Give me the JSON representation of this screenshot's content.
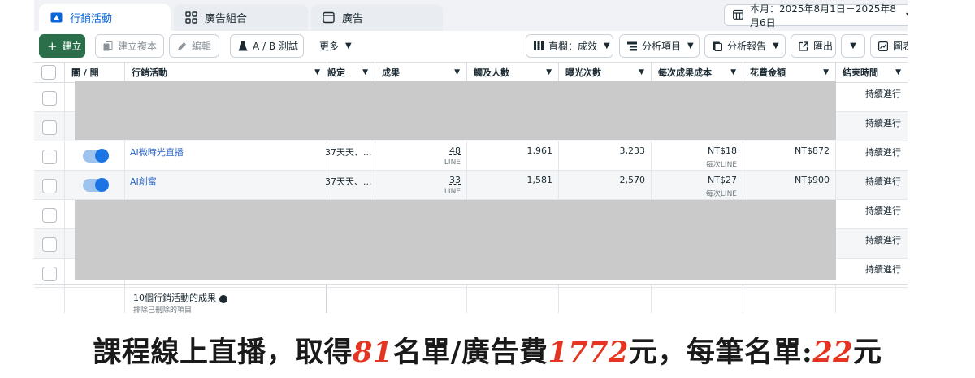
{
  "tabs": [
    {
      "label": "行銷活動",
      "icon": "campaign-icon"
    },
    {
      "label": "廣告組合",
      "icon": "grid-icon"
    },
    {
      "label": "廣告",
      "icon": "ad-icon"
    }
  ],
  "date_range": "本月：2025年8月1日－2025年8月6日",
  "toolbar": {
    "create": "建立",
    "duplicate": "建立複本",
    "edit": "編輯",
    "ab_test": "A / B 測試",
    "more": "更多",
    "columns": "直欄：成效",
    "breakdown": "分析項目",
    "reports": "分析報告",
    "export": "匯出",
    "chart": "圖表"
  },
  "columns": {
    "toggle": "關 / 開",
    "campaign": "行銷活動",
    "setting": "設定",
    "results": "成果",
    "reach": "觸及人數",
    "impressions": "曝光次數",
    "cost_per_result": "每次成果成本",
    "spend": "花費金額",
    "end_time": "結束時間"
  },
  "rows": [
    {
      "name": "",
      "setting": "",
      "results": "",
      "result_type": "",
      "reach": "",
      "impressions": "",
      "cost": "",
      "cost_sub": "",
      "spend": "",
      "end": "持續進行"
    },
    {
      "name": "",
      "setting": "",
      "results": "",
      "result_type": "",
      "reach": "",
      "impressions": "",
      "cost": "",
      "cost_sub": "",
      "spend": "",
      "end": "持續進行"
    },
    {
      "name": "AI微時光直播",
      "setting": "37天天、...",
      "results": "48",
      "result_type": "LINE",
      "reach": "1,961",
      "impressions": "3,233",
      "cost": "NT$18",
      "cost_sub": "每次LINE",
      "spend": "NT$872",
      "end": "持續進行"
    },
    {
      "name": "AI創富",
      "setting": "37天天、...",
      "results": "33",
      "result_type": "LINE",
      "reach": "1,581",
      "impressions": "2,570",
      "cost": "NT$27",
      "cost_sub": "每次LINE",
      "spend": "NT$900",
      "end": "持續進行"
    },
    {
      "name": "",
      "setting": "",
      "results": "",
      "result_type": "",
      "reach": "",
      "impressions": "",
      "cost": "",
      "cost_sub": "",
      "spend": "",
      "end": "持續進行"
    },
    {
      "name": "",
      "setting": "",
      "results": "",
      "result_type": "",
      "reach": "",
      "impressions": "",
      "cost": "",
      "cost_sub": "",
      "spend": "",
      "end": "持續進行"
    },
    {
      "name": "",
      "setting": "",
      "results": "",
      "result_type": "",
      "reach": "",
      "impressions": "",
      "cost": "",
      "cost_sub": "",
      "spend": "",
      "end": "持續進行"
    }
  ],
  "summary": {
    "title": "10個行銷活動的成果",
    "subtitle": "排除已刪除的項目"
  },
  "caption": {
    "part1": "課程線上直播，取得",
    "leads": "81",
    "part2": "名單/廣告費",
    "spend": "1772",
    "part3": "元，每筆名單:",
    "cpl": "22",
    "part4": "元"
  },
  "colors": {
    "primary_button": "#2b6e4a",
    "link": "#2b64c5",
    "toggle_on": "#1b74e4",
    "caption_highlight": "#e53522",
    "redaction": "#cacaca"
  }
}
